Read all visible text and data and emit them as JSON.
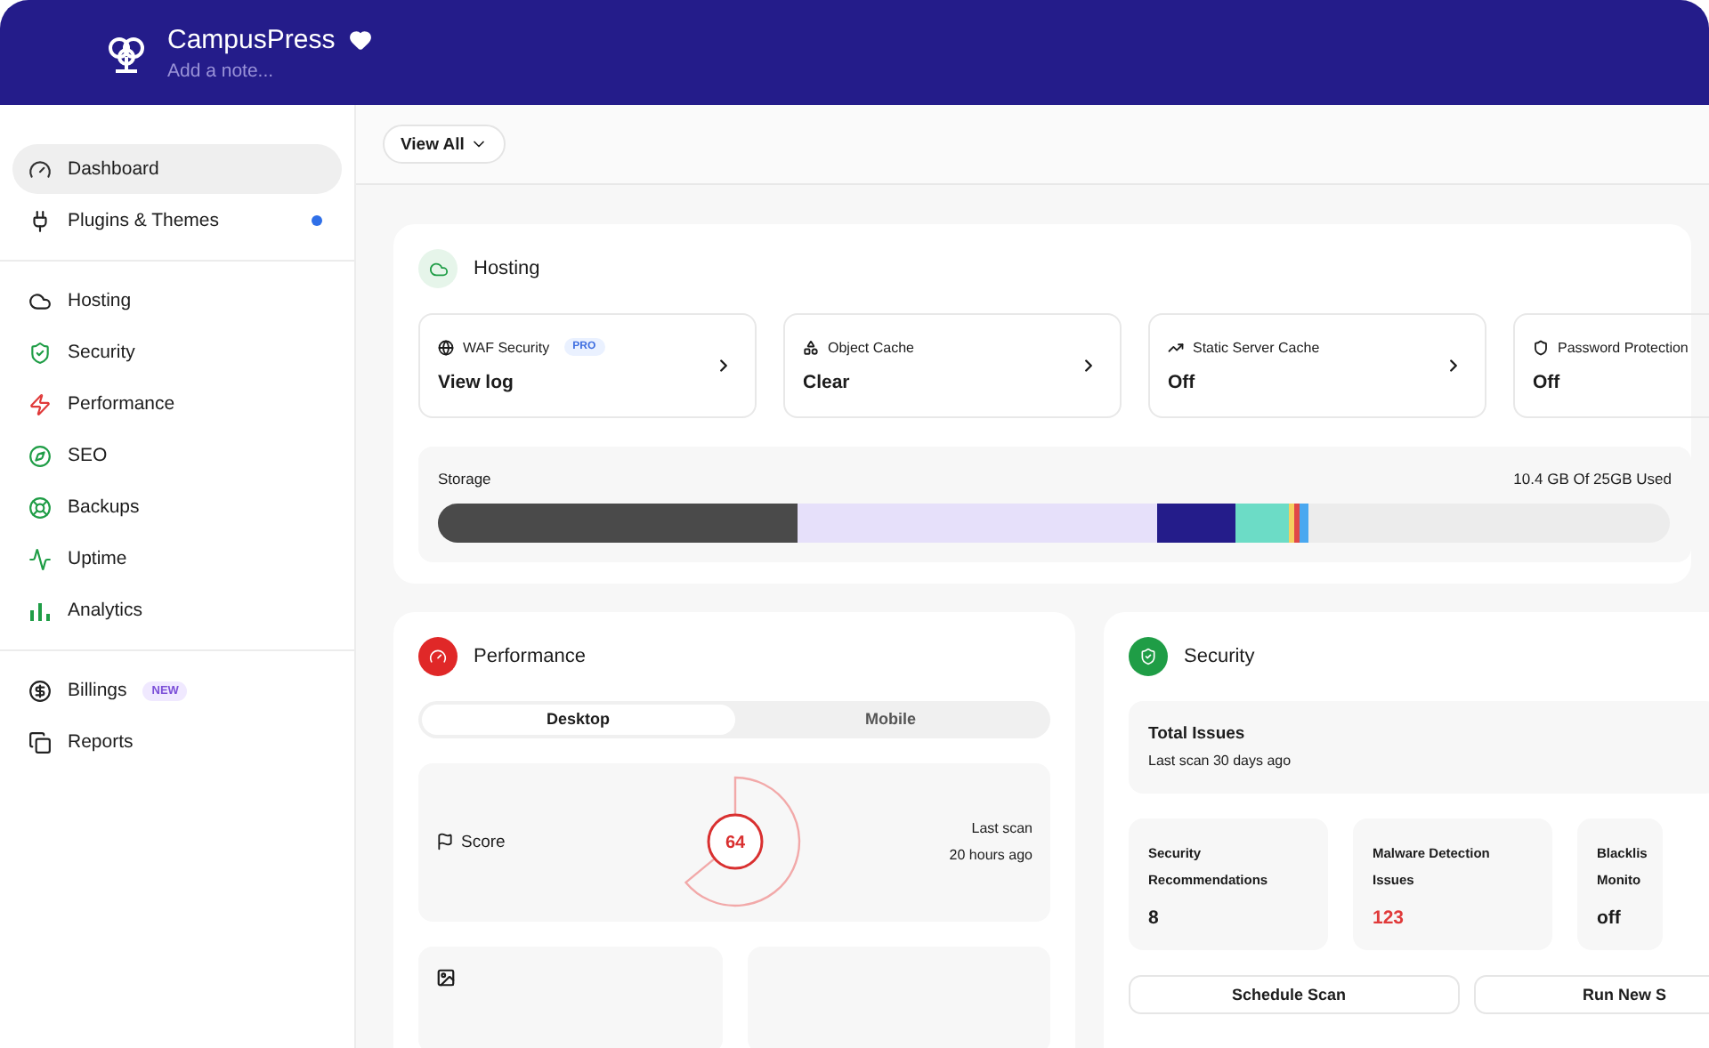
{
  "header": {
    "title": "CampusPress",
    "note_placeholder": "Add a note...",
    "favorite": true
  },
  "sidebar": {
    "groups": [
      {
        "items": [
          {
            "label": "Dashboard",
            "selected": true,
            "notification": false
          },
          {
            "label": "Plugins & Themes",
            "selected": false,
            "notification": true
          }
        ]
      },
      {
        "items": [
          {
            "label": "Hosting",
            "selected": false,
            "notification": false
          },
          {
            "label": "Security",
            "selected": false,
            "notification": false
          },
          {
            "label": "Performance",
            "selected": false,
            "notification": false
          },
          {
            "label": "SEO",
            "selected": false,
            "notification": false
          },
          {
            "label": "Backups",
            "selected": false,
            "notification": false
          },
          {
            "label": "Uptime",
            "selected": false,
            "notification": false
          },
          {
            "label": "Analytics",
            "selected": false,
            "notification": false
          }
        ]
      },
      {
        "items": [
          {
            "label": "Billings",
            "badge": "NEW",
            "selected": false,
            "notification": false
          },
          {
            "label": "Reports",
            "selected": false,
            "notification": false
          }
        ]
      }
    ]
  },
  "toolbar": {
    "filter": "View All"
  },
  "hosting": {
    "title": "Hosting",
    "features": [
      {
        "label": "WAF Security",
        "badge": "PRO",
        "value": "View log"
      },
      {
        "label": "Object Cache",
        "value": "Clear"
      },
      {
        "label": "Static Server Cache",
        "value": "Off"
      },
      {
        "label": "Password Protection",
        "value": "Off"
      }
    ],
    "storage": {
      "label": "Storage",
      "usage": "10.4 GB Of 25GB Used"
    }
  },
  "performance": {
    "title": "Performance",
    "tabs": [
      {
        "label": "Desktop",
        "selected": true
      },
      {
        "label": "Mobile",
        "selected": false
      }
    ],
    "score": {
      "label": "Score",
      "value": "64",
      "scan_label": "Last scan",
      "scan_time": "20 hours ago"
    }
  },
  "security": {
    "title": "Security",
    "total": {
      "title": "Total Issues",
      "subtitle": "Last scan 30 days ago"
    },
    "stats": [
      {
        "label": "Security Recommendations",
        "value": "8",
        "alert": false
      },
      {
        "label": "Malware Detection Issues",
        "value": "123",
        "alert": true
      },
      {
        "label": "Blacklis Monito",
        "value": "off",
        "alert": false
      }
    ],
    "buttons": [
      "Schedule Scan",
      "Run New S"
    ]
  }
}
